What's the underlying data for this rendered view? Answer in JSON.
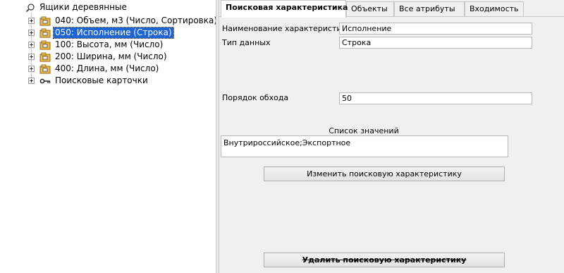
{
  "tree": {
    "root_label": "Ящики деревянные",
    "items": [
      {
        "label": "040: Объем, м3 (Число, Сортировка)",
        "selected": false
      },
      {
        "label": "050: Исполнение (Строка)",
        "selected": true
      },
      {
        "label": "100: Высота, мм (Число)",
        "selected": false
      },
      {
        "label": "200: Ширина, мм (Число)",
        "selected": false
      },
      {
        "label": "400: Длина, мм (Число)",
        "selected": false
      },
      {
        "label": "Поисковые карточки",
        "selected": false
      }
    ]
  },
  "tabs": [
    {
      "label": "Поисковая характеристика",
      "active": true
    },
    {
      "label": "Объекты",
      "active": false
    },
    {
      "label": "Все атрибуты",
      "active": false
    },
    {
      "label": "Входимость",
      "active": false
    }
  ],
  "form": {
    "name_label": "Наименование характеристики",
    "name_value": "Исполнение",
    "type_label": "Тип данных",
    "type_value": "Строка",
    "order_label": "Порядок обхода",
    "order_value": "50",
    "list_caption": "Список значений",
    "list_value": "Внутрироссийское;Экспортное"
  },
  "buttons": {
    "change_label": "Изменить поисковую характеристику",
    "delete_label": "Удалить поисковую характеристику"
  },
  "colors": {
    "selection": "#1e64d2",
    "panel_bg": "#f0f0f0"
  }
}
